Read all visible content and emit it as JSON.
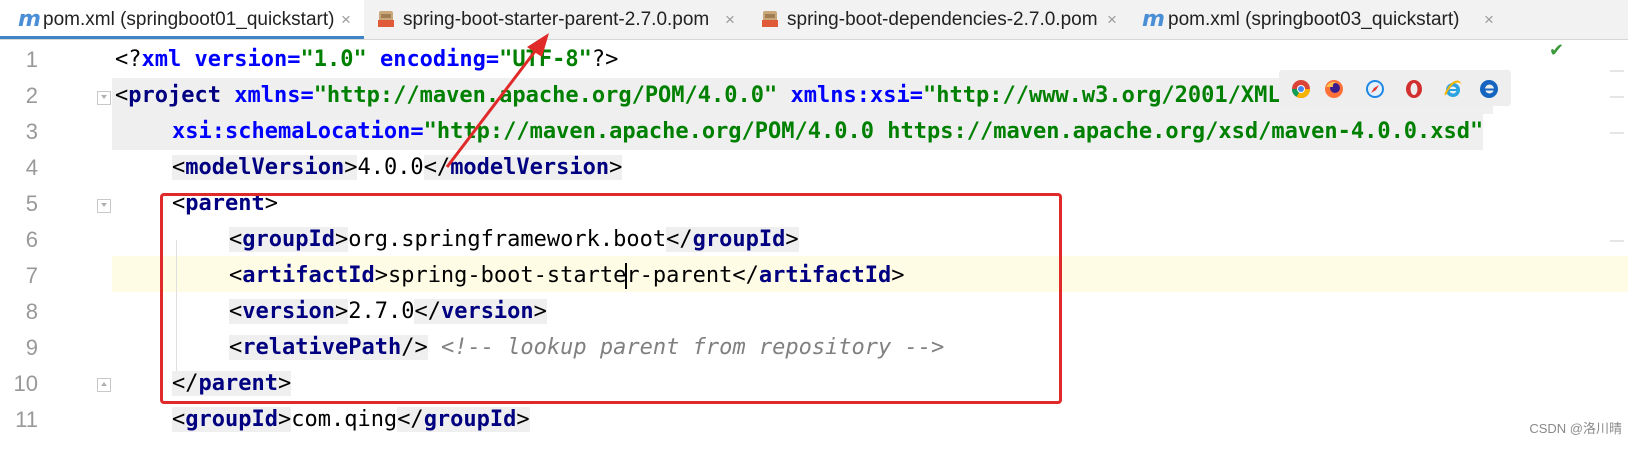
{
  "tabs": [
    {
      "icon": "maven-m-icon",
      "label": "pom.xml (springboot01_quickstart)",
      "close": "×",
      "active": true
    },
    {
      "icon": "jar-file-icon",
      "label": "spring-boot-starter-parent-2.7.0.pom",
      "close": "×",
      "active": false
    },
    {
      "icon": "jar-file-icon",
      "label": "spring-boot-dependencies-2.7.0.pom",
      "close": "×",
      "active": false
    },
    {
      "icon": "maven-m-icon",
      "label": "pom.xml (springboot03_quickstart)",
      "close": "×",
      "active": false
    }
  ],
  "icon_letter": "m",
  "line_numbers": [
    "1",
    "2",
    "3",
    "4",
    "5",
    "6",
    "7",
    "8",
    "9",
    "10",
    "11"
  ],
  "code": {
    "l1": {
      "a": "<?",
      "b": "xml",
      "c": " version=",
      "d": "\"1.0\"",
      "e": " encoding=",
      "f": "\"UTF-8\"",
      "g": "?>"
    },
    "l2": {
      "a": "<",
      "b": "project",
      "c": " xmlns=",
      "d": "\"http://maven.apache.org/POM/4.0.0\"",
      "e": " xmlns:xsi=",
      "f": "\"http://www.w3.org/2001/XMLSchema-instance\""
    },
    "l3": {
      "a": "xsi:schemaLocation=",
      "b": "\"http://maven.apache.org/POM/4.0.0 https://maven.apache.org/xsd/maven-4.0.0.xsd\""
    },
    "l4": {
      "open": "modelVersion",
      "value": "4.0.0",
      "close": "modelVersion"
    },
    "l5": {
      "open": "parent"
    },
    "l6": {
      "open": "groupId",
      "value": "org.springframework.boot",
      "close": "groupId"
    },
    "l7": {
      "open": "artifactId",
      "value_a": "spring-boot-starte",
      "value_b": "r-parent",
      "close": "artifactId"
    },
    "l8": {
      "open": "version",
      "value": "2.7.0",
      "close": "version"
    },
    "l9": {
      "tag": "relativePath",
      "comment": "<!-- lookup parent from repository -->"
    },
    "l10": {
      "close": "parent"
    },
    "l11": {
      "open": "groupId",
      "value": "com.qing",
      "close": "groupId"
    }
  },
  "browsers": [
    "chrome-icon",
    "firefox-icon",
    "safari-icon",
    "opera-icon",
    "ie-icon",
    "edge-icon"
  ],
  "colors": {
    "tag": "#000080",
    "attr": "#0000ff",
    "string": "#008000",
    "comment": "#808080",
    "annotation": "#e02a2a",
    "tab_active": "#3f85c6"
  },
  "status_check": "✔",
  "watermark": "CSDN @洛川晴"
}
